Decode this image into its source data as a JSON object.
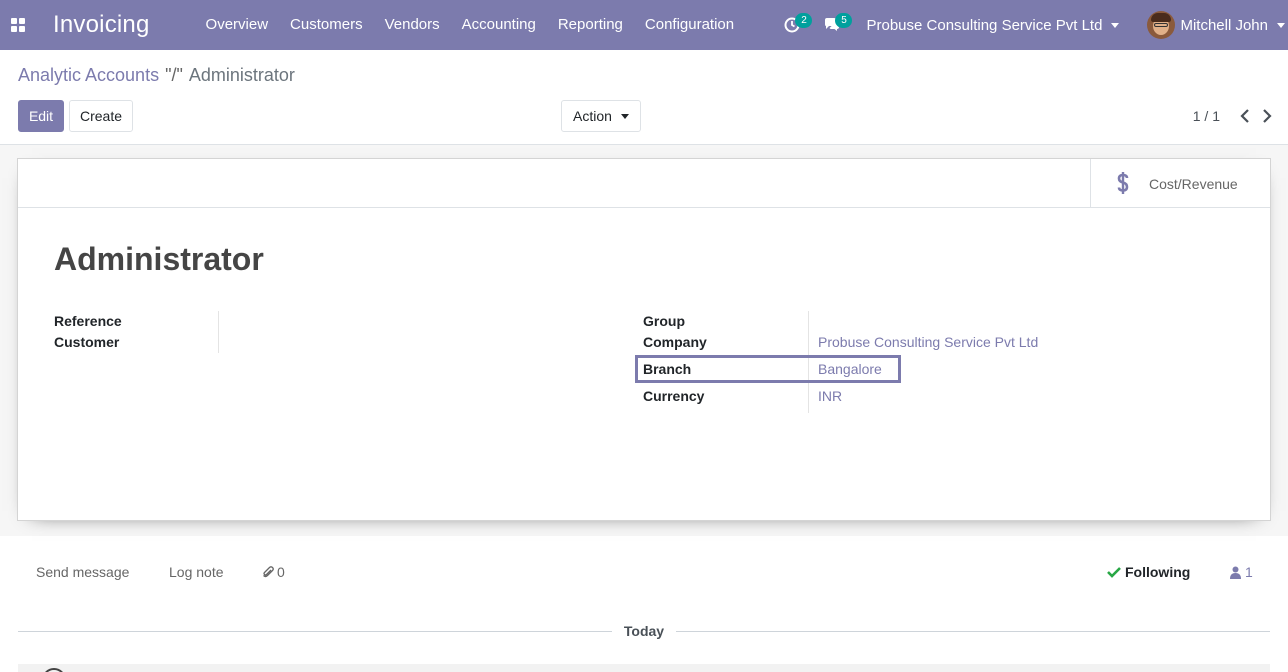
{
  "navbar": {
    "app_title": "Invoicing",
    "menu": [
      "Overview",
      "Customers",
      "Vendors",
      "Accounting",
      "Reporting",
      "Configuration"
    ],
    "activity_count": "2",
    "message_count": "5",
    "company": "Probuse Consulting Service Pvt Ltd",
    "user": "Mitchell John"
  },
  "breadcrumb": {
    "parent": "Analytic Accounts",
    "separator": "\"/\"",
    "current": "Administrator"
  },
  "buttons": {
    "edit": "Edit",
    "create": "Create",
    "action": "Action"
  },
  "pager": {
    "value": "1 / 1"
  },
  "smart_button": {
    "label": "Cost/Revenue"
  },
  "record": {
    "title": "Administrator",
    "left_fields": [
      {
        "label": "Reference",
        "value": ""
      },
      {
        "label": "Customer",
        "value": ""
      }
    ],
    "right_fields": [
      {
        "label": "Group",
        "value": ""
      },
      {
        "label": "Company",
        "value": "Probuse Consulting Service Pvt Ltd"
      },
      {
        "label": "Branch",
        "value": "Bangalore"
      },
      {
        "label": "Currency",
        "value": "INR"
      }
    ]
  },
  "chatter": {
    "send_message": "Send message",
    "log_note": "Log note",
    "attachments": "0",
    "following": "Following",
    "followers": "1",
    "date_separator": "Today"
  },
  "colors": {
    "brand": "#7c7bad",
    "badge": "#00a09d",
    "following_check": "#28a745"
  }
}
